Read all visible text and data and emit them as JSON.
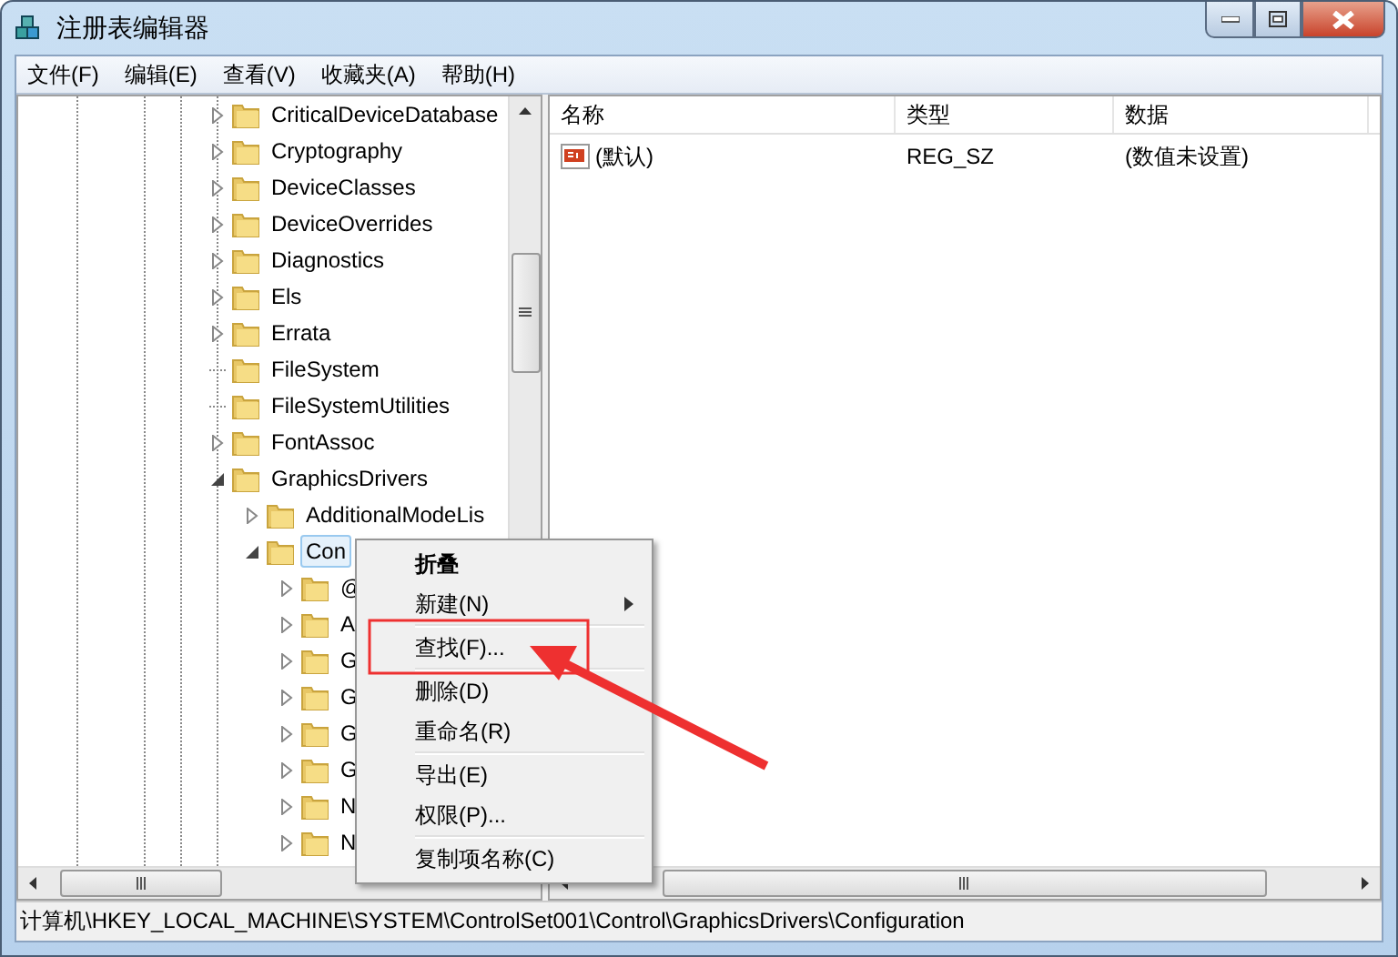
{
  "window": {
    "title": "注册表编辑器"
  },
  "menu_bar": [
    "文件(F)",
    "编辑(E)",
    "查看(V)",
    "收藏夹(A)",
    "帮助(H)"
  ],
  "tree": {
    "items": [
      {
        "label": "CriticalDeviceDatabase",
        "expanded": false,
        "has_children": true,
        "selected": false
      },
      {
        "label": "Cryptography",
        "expanded": false,
        "has_children": true,
        "selected": false
      },
      {
        "label": "DeviceClasses",
        "expanded": false,
        "has_children": true,
        "selected": false
      },
      {
        "label": "DeviceOverrides",
        "expanded": false,
        "has_children": true,
        "selected": false
      },
      {
        "label": "Diagnostics",
        "expanded": false,
        "has_children": true,
        "selected": false
      },
      {
        "label": "Els",
        "expanded": false,
        "has_children": true,
        "selected": false
      },
      {
        "label": "Errata",
        "expanded": false,
        "has_children": true,
        "selected": false
      },
      {
        "label": "FileSystem",
        "has_children": false,
        "selected": false
      },
      {
        "label": "FileSystemUtilities",
        "has_children": false,
        "selected": false
      },
      {
        "label": "FontAssoc",
        "expanded": false,
        "has_children": true,
        "selected": false
      },
      {
        "label": "GraphicsDrivers",
        "expanded": true,
        "has_children": true,
        "selected": false,
        "children": [
          {
            "label": "AdditionalModeLis",
            "expanded": false,
            "has_children": true,
            "selected": false
          },
          {
            "label": "Con",
            "expanded": true,
            "has_children": true,
            "selected": true,
            "children": [
              {
                "label": "@",
                "expanded": false,
                "has_children": true,
                "selected": false
              },
              {
                "label": "A",
                "expanded": false,
                "has_children": true,
                "selected": false
              },
              {
                "label": "G",
                "expanded": false,
                "has_children": true,
                "selected": false
              },
              {
                "label": "G",
                "expanded": false,
                "has_children": true,
                "selected": false
              },
              {
                "label": "G",
                "expanded": false,
                "has_children": true,
                "selected": false
              },
              {
                "label": "G",
                "expanded": false,
                "has_children": true,
                "selected": false
              },
              {
                "label": "N",
                "expanded": false,
                "has_children": true,
                "selected": false
              },
              {
                "label": "N",
                "expanded": false,
                "has_children": true,
                "selected": false
              }
            ]
          }
        ]
      }
    ]
  },
  "list": {
    "columns": [
      "名称",
      "类型",
      "数据"
    ],
    "rows": [
      {
        "name": "(默认)",
        "type": "REG_SZ",
        "data": "(数值未设置)"
      }
    ]
  },
  "context_menu": {
    "items": [
      {
        "kind": "item",
        "label": "折叠",
        "bold": true,
        "submenu": false,
        "highlighted": false
      },
      {
        "kind": "item",
        "label": "新建(N)",
        "bold": false,
        "submenu": true,
        "highlighted": false
      },
      {
        "kind": "separator"
      },
      {
        "kind": "item",
        "label": "查找(F)...",
        "bold": false,
        "submenu": false,
        "highlighted": true
      },
      {
        "kind": "separator"
      },
      {
        "kind": "item",
        "label": "删除(D)",
        "bold": false,
        "submenu": false,
        "highlighted": false
      },
      {
        "kind": "item",
        "label": "重命名(R)",
        "bold": false,
        "submenu": false,
        "highlighted": false
      },
      {
        "kind": "separator"
      },
      {
        "kind": "item",
        "label": "导出(E)",
        "bold": false,
        "submenu": false,
        "highlighted": false
      },
      {
        "kind": "item",
        "label": "权限(P)...",
        "bold": false,
        "submenu": false,
        "highlighted": false
      },
      {
        "kind": "separator"
      },
      {
        "kind": "item",
        "label": "复制项名称(C)",
        "bold": false,
        "submenu": false,
        "highlighted": false
      }
    ]
  },
  "status_bar": "计算机\\HKEY_LOCAL_MACHINE\\SYSTEM\\ControlSet001\\Control\\GraphicsDrivers\\Configuration"
}
